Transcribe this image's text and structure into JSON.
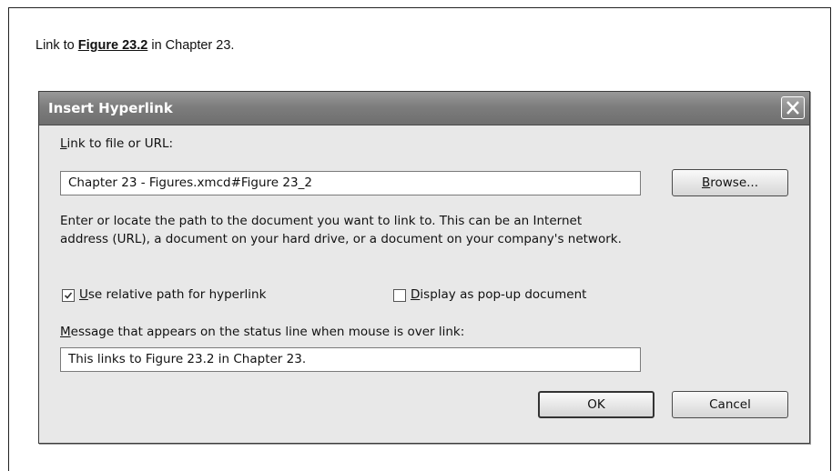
{
  "intro": {
    "prefix": "Link to ",
    "link_text": "Figure 23.2",
    "suffix": " in Chapter 23."
  },
  "dialog": {
    "title": "Insert Hyperlink",
    "close_icon": "close-x-icon",
    "link_label_accel": "L",
    "link_label_rest": "ink to file or URL:",
    "link_value": "Chapter 23 - Figures.xmcd#Figure 23_2",
    "browse_accel": "B",
    "browse_rest": "rowse...",
    "description_line1": "Enter or locate the path to the document you want to link to. This can be an Internet",
    "description_line2": "address (URL), a document on your hard drive, or a document on your company's network.",
    "relative_path": {
      "accel": "U",
      "rest": "se relative path for hyperlink",
      "checked": true
    },
    "popup": {
      "accel": "D",
      "rest": "isplay as pop-up document",
      "checked": false
    },
    "message_label_accel": "M",
    "message_label_rest": "essage that appears on the status line when mouse is over link:",
    "message_value": "This links to Figure 23.2 in Chapter 23.",
    "ok_label": "OK",
    "cancel_label": "Cancel"
  }
}
